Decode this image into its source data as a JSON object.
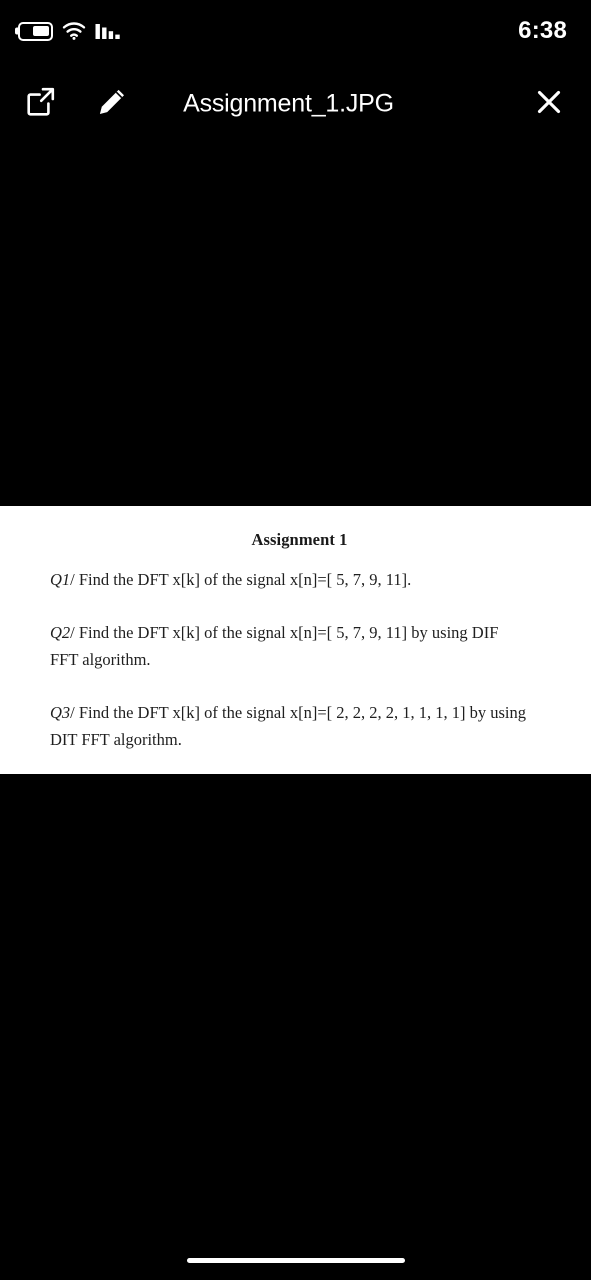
{
  "status_bar": {
    "battery_icon": "battery-icon",
    "battery_level_percent": 58,
    "wifi_icon": "wifi-icon",
    "signal_icon": "cellular-signal-icon",
    "time": "6:38"
  },
  "toolbar": {
    "share_icon": "share-external-link-icon",
    "edit_icon": "pencil-edit-icon",
    "title": "Assignment_1.JPG",
    "close_icon": "close-x-icon"
  },
  "document": {
    "heading": "Assignment 1",
    "questions": [
      {
        "label": "Q1",
        "text": "/ Find the DFT x[k] of the signal x[n]=[ 5, 7, 9, 11]."
      },
      {
        "label": "Q2",
        "text": "/ Find the DFT x[k] of the signal x[n]=[ 5, 7, 9, 11] by using DIF FFT algorithm."
      },
      {
        "label": "Q3",
        "text": "/ Find the DFT x[k] of the signal x[n]=[ 2, 2, 2, 2, 1, 1, 1, 1] by using DIT FFT algorithm."
      }
    ]
  },
  "colors": {
    "background": "#000000",
    "page": "#ffffff",
    "text_on_dark": "#ffffff",
    "text_on_page": "#1f1f1f"
  },
  "home_indicator": "home-indicator-bar"
}
